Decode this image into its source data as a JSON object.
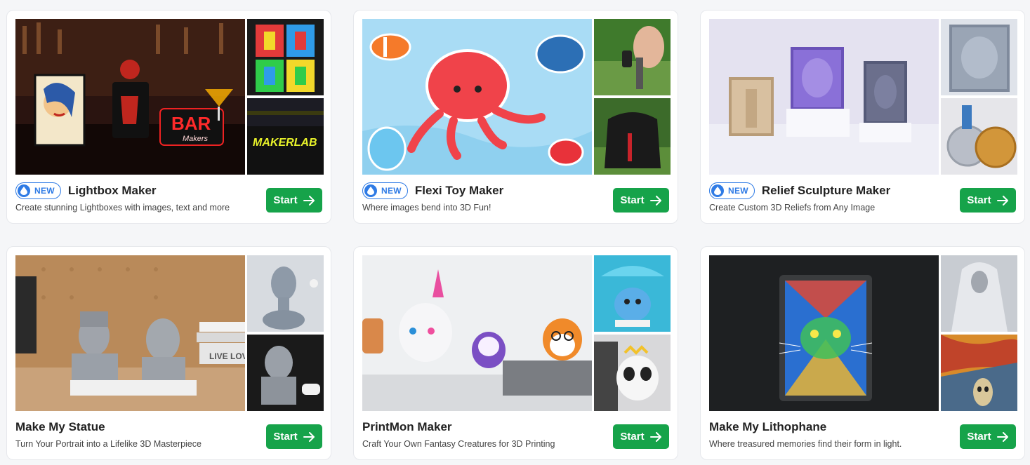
{
  "accent_color": "#16a34a",
  "badge_color": "#2f7be5",
  "cards": [
    {
      "title": "Lightbox Maker",
      "desc": "Create stunning Lightboxes with images, text and more",
      "badge": "NEW",
      "start": "Start",
      "main_text": "BAR",
      "main_subtext": "Makers",
      "side_text": "MAKERLAB"
    },
    {
      "title": "Flexi Toy Maker",
      "desc": "Where images bend into 3D Fun!",
      "badge": "NEW",
      "start": "Start"
    },
    {
      "title": "Relief Sculpture Maker",
      "desc": "Create Custom 3D Reliefs from Any Image",
      "badge": "NEW",
      "start": "Start"
    },
    {
      "title": "Make My Statue",
      "desc": "Turn Your Portrait into a Lifelike 3D Masterpiece",
      "start": "Start",
      "book_text": "LIVE LOVE"
    },
    {
      "title": "PrintMon Maker",
      "desc": "Craft Your Own Fantasy Creatures for 3D Printing",
      "start": "Start"
    },
    {
      "title": "Make My Lithophane",
      "desc": "Where treasured memories find their form in light.",
      "start": "Start"
    }
  ]
}
